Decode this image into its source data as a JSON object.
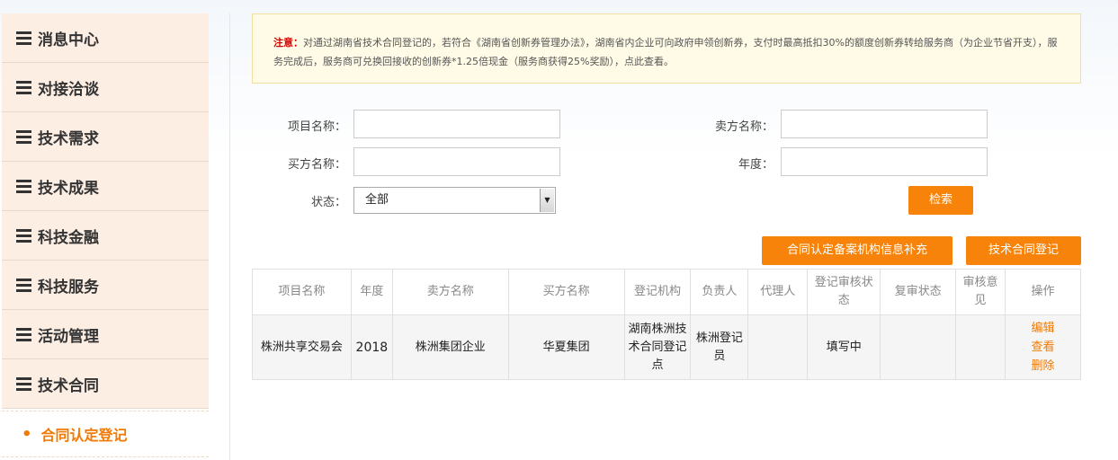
{
  "sidebar": {
    "items": [
      {
        "label": "消息中心"
      },
      {
        "label": "对接洽谈"
      },
      {
        "label": "技术需求"
      },
      {
        "label": "技术成果"
      },
      {
        "label": "科技金融"
      },
      {
        "label": "科技服务"
      },
      {
        "label": "活动管理"
      },
      {
        "label": "技术合同"
      }
    ],
    "active_sub": {
      "bullet": "•",
      "label": "合同认定登记"
    }
  },
  "notice": {
    "prefix": "注意：",
    "text": "对通过湖南省技术合同登记的，若符合《湖南省创新券管理办法》，湖南省内企业可向政府申领创新券，支付时最高抵扣30%的额度创新券转给服务商（为企业节省开支），服务完成后，服务商可兑换回接收的创新券*1.25倍现金（服务商获得25%奖励），点此查看。"
  },
  "search": {
    "project_label": "项目名称：",
    "project_value": "",
    "seller_label": "卖方名称：",
    "seller_value": "",
    "buyer_label": "买方名称：",
    "buyer_value": "",
    "year_label": "年度：",
    "year_value": "",
    "status_label": "状态：",
    "status_value": "全部",
    "search_button": "检索"
  },
  "actions": {
    "supplement_button": "合同认定备案机构信息补充",
    "register_button": "技术合同登记"
  },
  "table": {
    "headers": [
      "项目名称",
      "年度",
      "卖方名称",
      "买方名称",
      "登记机构",
      "负责人",
      "代理人",
      "登记审核状态",
      "复审状态",
      "审核意见",
      "操作"
    ],
    "rows": [
      {
        "project": "株洲共享交易会",
        "year": "2018",
        "seller": "株洲集团企业",
        "buyer": "华夏集团",
        "agency": "湖南株洲技术合同登记点",
        "owner": "株洲登记员",
        "agent": "",
        "audit_status": "填写中",
        "review_status": "",
        "opinion": "",
        "ops": [
          "编辑",
          "查看",
          "删除"
        ]
      }
    ]
  },
  "colors": {
    "accent": "#f7830b",
    "sidebar_bg": "#fdeee4",
    "notice_bg": "#fffbe6"
  }
}
